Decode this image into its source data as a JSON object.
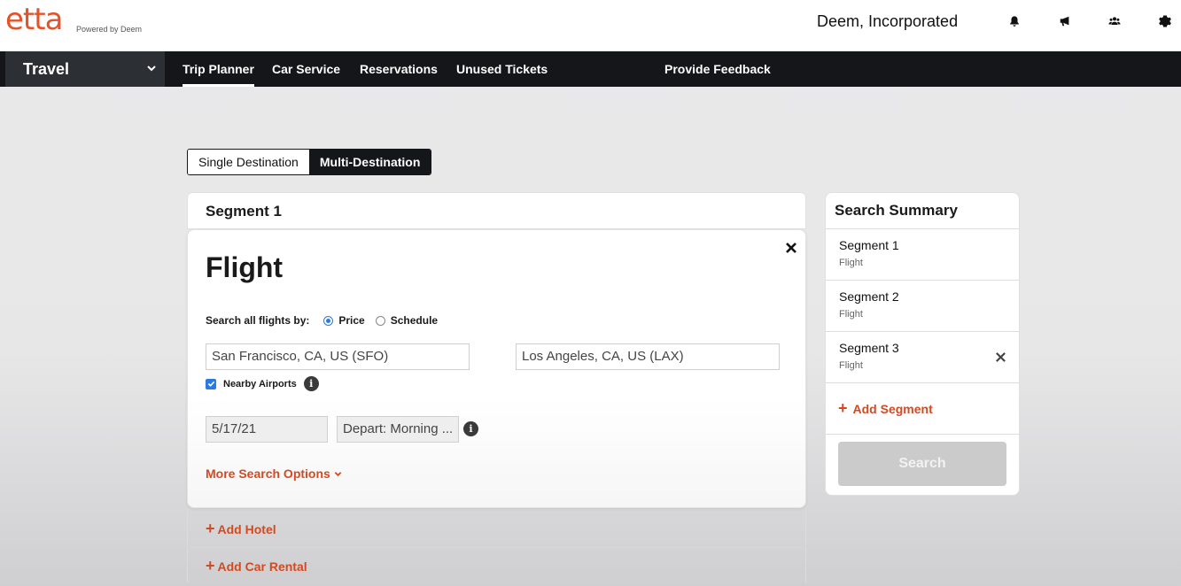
{
  "header": {
    "logo": "etta",
    "logo_sub": "Powered by Deem",
    "company": "Deem, Incorporated"
  },
  "nav": {
    "selector": "Travel",
    "links": [
      "Trip Planner",
      "Car Service",
      "Reservations",
      "Unused Tickets"
    ],
    "feedback": "Provide Feedback"
  },
  "toggle": {
    "single": "Single Destination",
    "multi": "Multi-Destination"
  },
  "segment": {
    "header": "Segment 1",
    "title": "Flight",
    "search_by_label": "Search all flights by:",
    "option_price": "Price",
    "option_schedule": "Schedule",
    "origin": "San Francisco, CA, US (SFO)",
    "destination": "Los Angeles, CA, US (LAX)",
    "nearby_label": "Nearby Airports",
    "date": "5/17/21",
    "depart": "Depart: Morning ...",
    "more_options": "More Search Options",
    "add_hotel": "Add Hotel",
    "add_car": "Add Car Rental"
  },
  "summary": {
    "title": "Search Summary",
    "items": [
      {
        "name": "Segment 1",
        "type": "Flight"
      },
      {
        "name": "Segment 2",
        "type": "Flight"
      },
      {
        "name": "Segment 3",
        "type": "Flight"
      }
    ],
    "add_segment": "Add Segment",
    "search_button": "Search"
  },
  "icons": {
    "bell": "bell-icon",
    "megaphone": "megaphone-icon",
    "users": "users-icon",
    "gear": "gear-icon"
  },
  "colors": {
    "accent": "#d04a22",
    "logo": "#e2532a",
    "nav_bg": "#14161a",
    "radio": "#2a7ae2"
  }
}
